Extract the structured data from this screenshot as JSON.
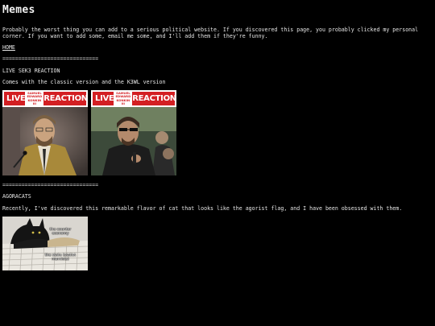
{
  "page": {
    "title": "Memes",
    "intro": "Probably the worst thing you can add to a serious political website. If you discovered this page, you probably clicked my personal corner. If you want to add some, email me some, and I'll add them if they're funny.",
    "home_link": "HOME",
    "divider": "=============================="
  },
  "sections": {
    "live_sek3": {
      "heading": "LIVE SEK3 REACTION",
      "description": "Comes with the classic version and the K3WL version",
      "images": [
        {
          "banner_left": "LIVE",
          "banner_name": "SAMUEL EDWARD KONKIN III",
          "banner_right": "REACTION"
        },
        {
          "banner_left": "LIVE",
          "banner_name": "SAMUEL EDWARD KONKIN III",
          "banner_right": "REACTION"
        }
      ]
    },
    "agoracats": {
      "heading": "AGORACATS",
      "description": "Recently, I've discovered this remarkable flavor of cat that looks like the agorist flag, and I have been obsessed with them.",
      "image": {
        "caption_top": "the counter economy",
        "caption_bottom": "the state (statist marxists)"
      }
    }
  },
  "colors": {
    "background": "#000000",
    "text": "#e6e6e6",
    "reaction_red": "#d31f23"
  }
}
